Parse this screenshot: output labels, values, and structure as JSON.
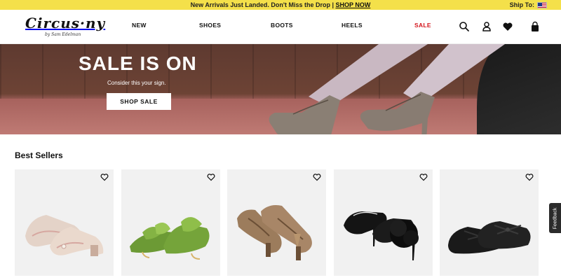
{
  "announcement": {
    "message": "New Arrivals Just Landed. Don't Miss the Drop | ",
    "link_label": "SHOP NOW",
    "ship_to_label": "Ship To:",
    "ship_to_flag": "us-flag-icon"
  },
  "header": {
    "logo_main": "Circus·ny",
    "logo_sub": "by Sam Edelman",
    "nav": [
      {
        "label": "NEW"
      },
      {
        "label": "SHOES"
      },
      {
        "label": "BOOTS"
      },
      {
        "label": "HEELS"
      },
      {
        "label": "SALE",
        "color": "#d4151c"
      }
    ],
    "icons": [
      "search-icon",
      "account-icon",
      "wishlist-heart-icon",
      "cart-bag-icon"
    ]
  },
  "hero": {
    "title": "SALE IS ON",
    "subtitle": "Consider this your sign.",
    "cta_label": "SHOP SALE"
  },
  "best_sellers": {
    "title": "Best Sellers",
    "products": [
      {
        "image": "tweed-block-heel-pumps",
        "wishlist_icon": "heart-outline-icon"
      },
      {
        "image": "green-bow-kitten-mules",
        "wishlist_icon": "heart-outline-icon"
      },
      {
        "image": "tan-tassel-loafer-pumps",
        "wishlist_icon": "heart-outline-icon"
      },
      {
        "image": "black-feather-logo-mules",
        "wishlist_icon": "heart-outline-icon"
      },
      {
        "image": "black-mary-jane-flats",
        "wishlist_icon": "heart-outline-icon"
      }
    ]
  },
  "feedback": {
    "label": "Feedback"
  },
  "colors": {
    "announcement_bg": "#f4e04a",
    "sale_red": "#d4151c",
    "product_bg": "#f1f1f1"
  }
}
